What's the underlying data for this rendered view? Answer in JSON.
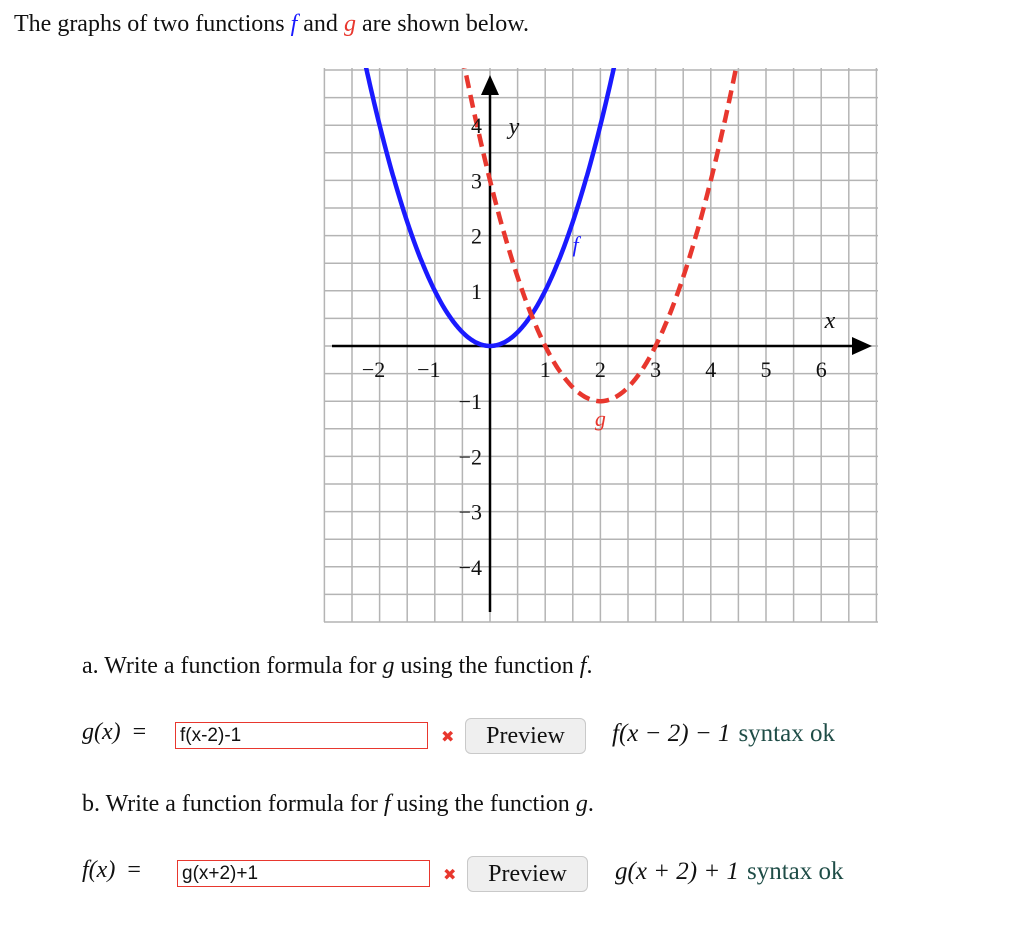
{
  "intro": {
    "prefix": "The graphs of two functions ",
    "f_name": "f",
    "middle": " and ",
    "g_name": "g",
    "suffix": " are shown below."
  },
  "colors": {
    "f": "#1a1aff",
    "g": "#e8372e",
    "grid": "#b4b4b4",
    "axis": "#000000",
    "syntax_ok": "#1f4d47",
    "input_border": "#e8372e"
  },
  "chart_data": {
    "type": "line",
    "title": "",
    "xlabel": "x",
    "ylabel": "y",
    "xlim": [
      -3,
      7
    ],
    "ylim": [
      -5,
      5
    ],
    "grid": true,
    "grid_step": 0.5,
    "x_ticks": [
      -2,
      -1,
      1,
      2,
      3,
      4,
      5,
      6
    ],
    "x_tick_labels": [
      "−2",
      "−1",
      "1",
      "2",
      "3",
      "4",
      "5",
      "6"
    ],
    "y_ticks": [
      4,
      3,
      2,
      1,
      -1,
      -2,
      -3,
      -4
    ],
    "y_tick_labels": [
      "4",
      "3",
      "2",
      "1",
      "−1",
      "−2",
      "−3",
      "−4"
    ],
    "series": [
      {
        "name": "f",
        "label": "f",
        "formula": "x^2",
        "style": "solid",
        "color": "#1a1aff",
        "vertex": [
          0,
          0
        ],
        "points": [
          [
            -2,
            4
          ],
          [
            -1,
            1
          ],
          [
            0,
            0
          ],
          [
            1,
            1
          ],
          [
            2,
            4
          ]
        ],
        "label_at": [
          1.55,
          1.7
        ]
      },
      {
        "name": "g",
        "label": "g",
        "formula": "(x-2)^2 - 1",
        "style": "dashed",
        "color": "#e8372e",
        "vertex": [
          2,
          -1
        ],
        "points": [
          [
            0,
            3
          ],
          [
            1,
            0
          ],
          [
            2,
            -1
          ],
          [
            3,
            0
          ],
          [
            4,
            3
          ]
        ],
        "label_at": [
          2,
          -1.45
        ]
      }
    ]
  },
  "part_a": {
    "question_prefix": "a. Write a function formula for ",
    "question_var": "g",
    "question_mid": " using the function ",
    "question_fn": "f",
    "question_end": ".",
    "lhs": "g(x)",
    "eq": "=",
    "input_value": "f(x-2)-1",
    "status_icon": "✖",
    "preview_label": "Preview",
    "rendered": "f(x − 2) − 1",
    "syntax_status": "syntax ok"
  },
  "part_b": {
    "question_prefix": "b. Write a function formula for ",
    "question_var": "f",
    "question_mid": " using the function ",
    "question_fn": "g",
    "question_end": ".",
    "lhs": "f(x)",
    "eq": "=",
    "input_value": "g(x+2)+1",
    "status_icon": "✖",
    "preview_label": "Preview",
    "rendered": "g(x + 2) + 1",
    "syntax_status": "syntax ok"
  }
}
